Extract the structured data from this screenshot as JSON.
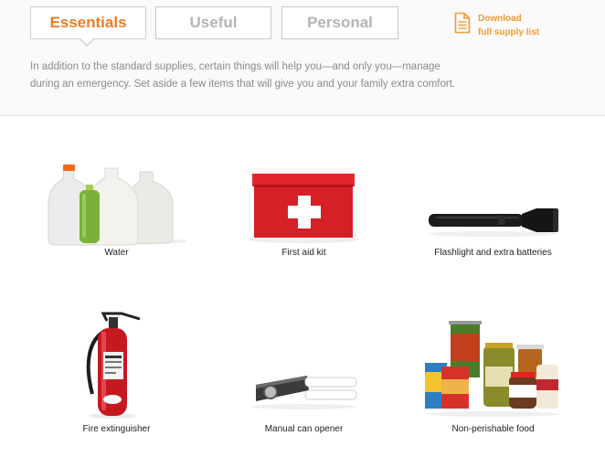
{
  "tabs": [
    {
      "label": "Essentials",
      "active": true
    },
    {
      "label": "Useful",
      "active": false
    },
    {
      "label": "Personal",
      "active": false
    }
  ],
  "download": {
    "line1": "Download",
    "line2": "full supply list",
    "icon": "document-icon"
  },
  "intro": "In addition to the standard supplies, certain things will help you—and only you—manage during an emergency. Set aside a few items that will give you and your family extra comfort.",
  "items": [
    {
      "caption": "Water",
      "image": "water-jugs"
    },
    {
      "caption": "First aid kit",
      "image": "first-aid-box"
    },
    {
      "caption": "Flashlight and extra batteries",
      "image": "flashlight"
    },
    {
      "caption": "Fire extinguisher",
      "image": "fire-extinguisher"
    },
    {
      "caption": "Manual can opener",
      "image": "can-opener"
    },
    {
      "caption": "Non-perishable food",
      "image": "canned-food"
    }
  ],
  "colors": {
    "accent": "#f07c21",
    "download": "#f39b33",
    "kit_red": "#d71f26"
  }
}
